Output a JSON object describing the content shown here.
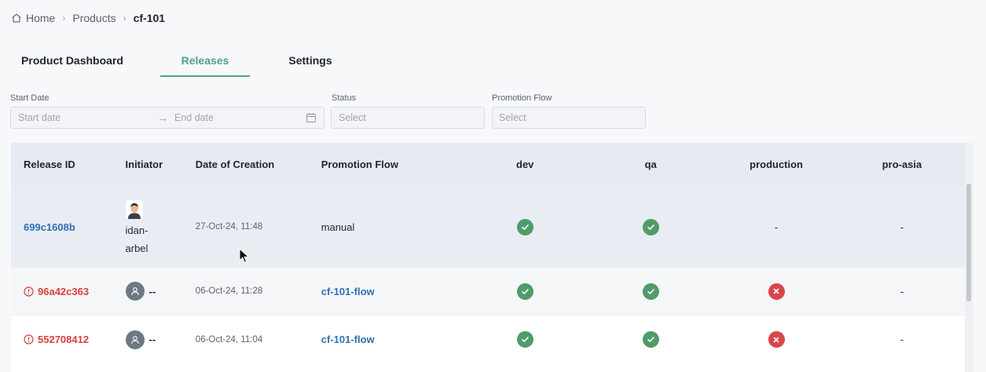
{
  "breadcrumb": {
    "home": "Home",
    "products": "Products",
    "current": "cf-101"
  },
  "tabs": {
    "dashboard": "Product Dashboard",
    "releases": "Releases",
    "settings": "Settings"
  },
  "filters": {
    "start_date_label": "Start Date",
    "start_placeholder": "Start date",
    "end_placeholder": "End date",
    "status_label": "Status",
    "status_placeholder": "Select",
    "flow_label": "Promotion Flow",
    "flow_placeholder": "Select"
  },
  "table": {
    "headers": {
      "release_id": "Release ID",
      "initiator": "Initiator",
      "date": "Date of Creation",
      "flow": "Promotion Flow",
      "dev": "dev",
      "qa": "qa",
      "production": "production",
      "pro_asia": "pro-asia"
    },
    "rows": [
      {
        "release_id": "699c1608b",
        "initiator_line1": "idan-",
        "initiator_line2": "arbel",
        "date": "27-Oct-24, 11:48",
        "flow": "manual",
        "dev": "success",
        "qa": "success",
        "production": "-",
        "pro_asia": "-"
      },
      {
        "release_id": "96a42c363",
        "initiator": "--",
        "date": "06-Oct-24, 11:28",
        "flow": "cf-101-flow",
        "dev": "success",
        "qa": "success",
        "production": "failed",
        "pro_asia": "-"
      },
      {
        "release_id": "552708412",
        "initiator": "--",
        "date": "06-Oct-24, 11:04",
        "flow": "cf-101-flow",
        "dev": "success",
        "qa": "success",
        "production": "failed",
        "pro_asia": "-"
      }
    ]
  },
  "colors": {
    "accent": "#4fa38b",
    "link": "#2f6fb3",
    "error": "#d84040",
    "success_badge": "#4f9b6a",
    "failed_badge": "#d9464a"
  },
  "icons": {
    "home": "home-icon",
    "calendar": "calendar-icon",
    "success": "check-circle-icon",
    "failed": "x-circle-icon",
    "error": "alert-circle-icon",
    "user": "user-avatar-icon"
  }
}
